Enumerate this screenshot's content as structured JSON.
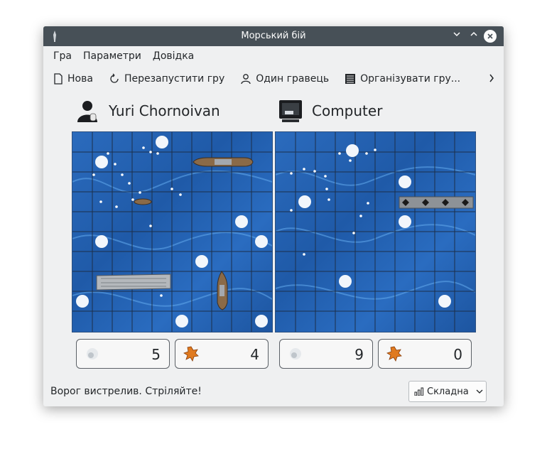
{
  "window": {
    "title": "Морський бій"
  },
  "menu": {
    "items": [
      "Гра",
      "Параметри",
      "Довідка"
    ]
  },
  "toolbar": {
    "new_label": "Нова",
    "restart_label": "Перезапустити гру",
    "single_label": "Один гравець",
    "organize_label": "Організувати гру..."
  },
  "players": {
    "left": {
      "name": "Yuri Chornoivan",
      "misses": "5",
      "hits": "4"
    },
    "right": {
      "name": "Computer",
      "misses": "9",
      "hits": "0"
    }
  },
  "status_text": "Ворог вистрелив. Стріляйте!",
  "difficulty": {
    "selected": "Складна"
  },
  "colors": {
    "titlebar": "#475057",
    "sea": "#2263b3",
    "window_bg": "#eff0f1"
  }
}
